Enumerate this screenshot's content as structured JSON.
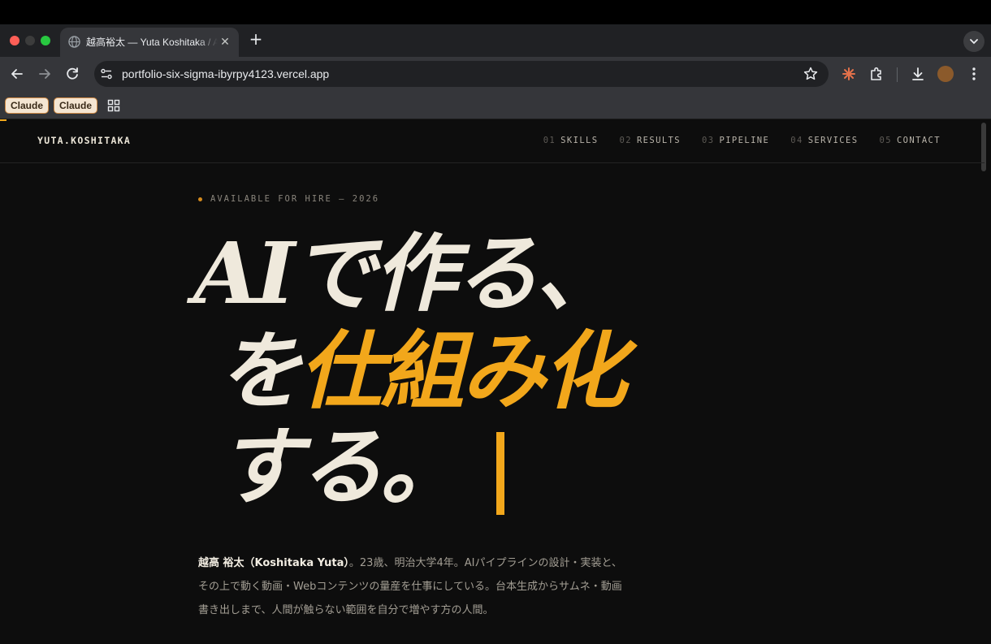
{
  "browser": {
    "tab": {
      "title": "越高裕太 — Yuta Koshitaka / AI",
      "close_glyph": "✕"
    },
    "new_tab_glyph": "+",
    "url": "portfolio-six-sigma-ibyrpy4123.vercel.app",
    "bookmarks": [
      "Claude",
      "Claude"
    ]
  },
  "site": {
    "brand": "YUTA.KOSHITAKA",
    "nav": [
      {
        "num": "01",
        "label": "SKILLS"
      },
      {
        "num": "02",
        "label": "RESULTS"
      },
      {
        "num": "03",
        "label": "PIPELINE"
      },
      {
        "num": "04",
        "label": "SERVICES"
      },
      {
        "num": "05",
        "label": "CONTACT"
      }
    ],
    "badge": "AVAILABLE FOR HIRE — 2026",
    "hero": {
      "line1": "AIで作る、",
      "line2_prefix": "を",
      "line2_accent": "仕組み化",
      "line3": "する。"
    },
    "bio": {
      "name": "越高 裕太（Koshitaka Yuta）",
      "text": "。23歳、明治大学4年。AIパイプラインの設計・実装と、その上で動く動画・Webコンテンツの量産を仕事にしている。台本生成からサムネ・動画書き出しまで、人間が触らない範囲を自分で増やす方の人間。"
    },
    "colors": {
      "accent": "#f2a71b",
      "background": "#0d0d0d",
      "text": "#efe9dc"
    }
  }
}
